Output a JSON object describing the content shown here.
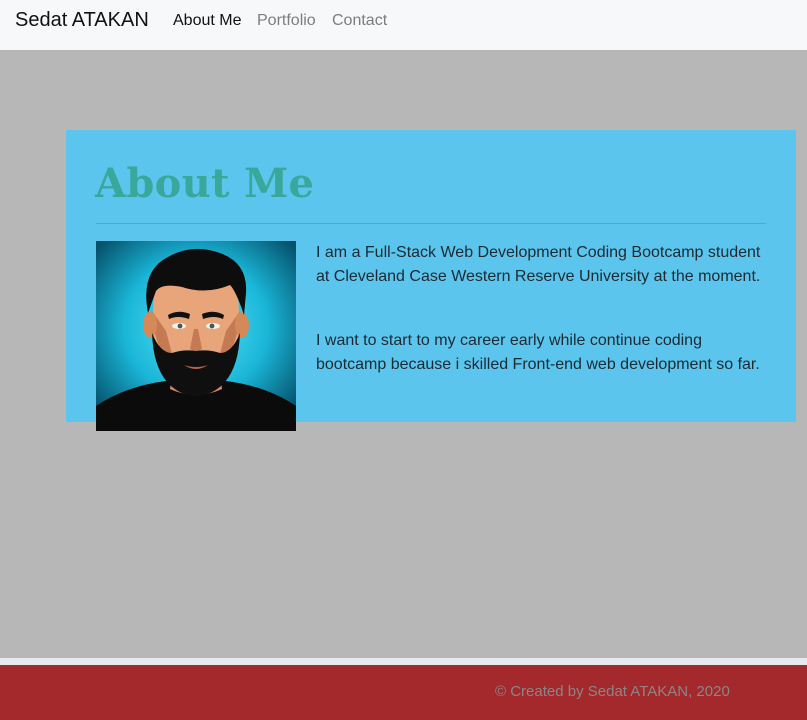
{
  "navbar": {
    "brand": "Sedat ATAKAN",
    "links": [
      {
        "label": "About Me",
        "active": true
      },
      {
        "label": "Portfolio",
        "active": false
      },
      {
        "label": "Contact",
        "active": false
      }
    ]
  },
  "about": {
    "title": "About Me",
    "paragraphs": [
      "I am a Full-Stack Web Development Coding Bootcamp student at Cleveland Case Western Reserve University at the moment.",
      "I want to start to my career early while continue coding bootcamp because i skilled Front-end web development so far."
    ],
    "avatar_alt": "avatar-illustration"
  },
  "footer": {
    "text": "© Created by Sedat ATAKAN, 2020"
  },
  "colors": {
    "page_bg": "#b7b7b7",
    "navbar_bg": "#f7f8fa",
    "card_bg": "#5bc5ed",
    "title_color": "#3aa79b",
    "footer_bg": "#a3292c"
  }
}
